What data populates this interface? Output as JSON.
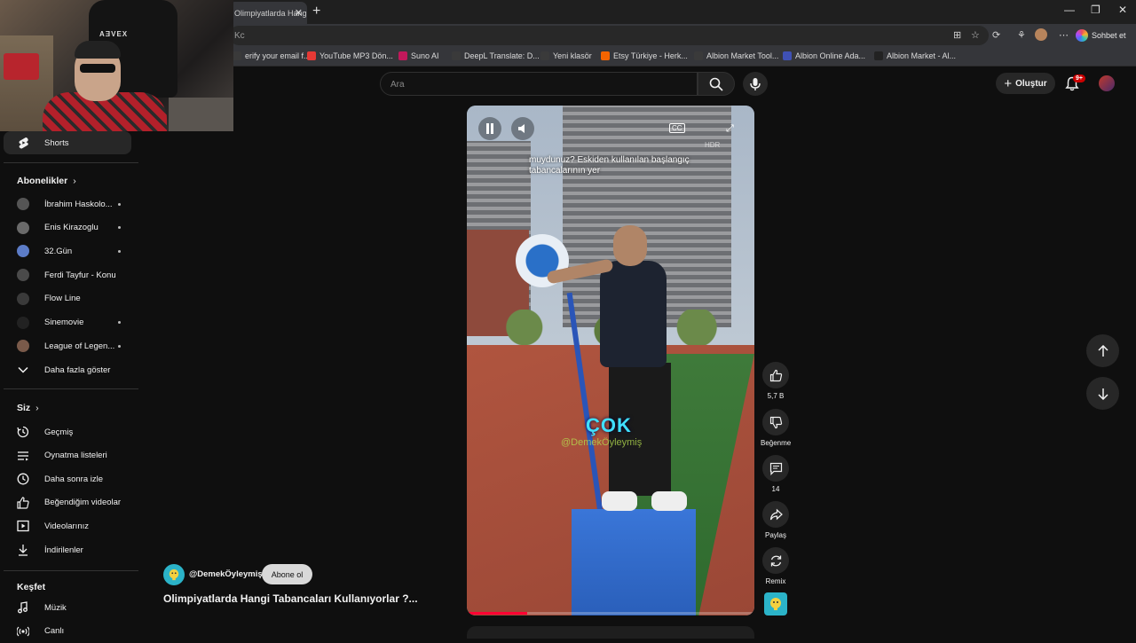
{
  "browser": {
    "tab_title": "Olimpiyatlarda Hangi Ta",
    "url_fragment": "Kc",
    "chat_button": "Sohbet et",
    "bookmarks": [
      {
        "label": "erify your email f...",
        "color": "#3a3a3a"
      },
      {
        "label": "YouTube MP3 Dön...",
        "color": "#e53935"
      },
      {
        "label": "Suno AI",
        "color": "#c2185b"
      },
      {
        "label": "DeepL Translate: D...",
        "color": "#3a3a3a"
      },
      {
        "label": "Yeni klasör",
        "color": "#3a3a3a"
      },
      {
        "label": "Etsy Türkiye - Herk...",
        "color": "#f56400"
      },
      {
        "label": "Albion Market Tool...",
        "color": "#3a3a3a"
      },
      {
        "label": "Albion Online Ada...",
        "color": "#3f51b5"
      },
      {
        "label": "Albion Market - Al...",
        "color": "#222222"
      }
    ]
  },
  "webcam": {
    "chair_brand": "AƎVEX"
  },
  "header": {
    "search_placeholder": "Ara",
    "create_label": "Oluştur",
    "notification_count": "9+"
  },
  "sidebar": {
    "shorts_label": "Shorts",
    "subscriptions_heading": "Abonelikler",
    "subscriptions": [
      {
        "label": "İbrahim Haskolo...",
        "dot": true,
        "color": "#555"
      },
      {
        "label": "Enis Kirazoglu",
        "dot": true,
        "color": "#6a6a6a"
      },
      {
        "label": "32.Gün",
        "dot": true,
        "color": "#5c7cc7"
      },
      {
        "label": "Ferdi Tayfur - Konu",
        "dot": false,
        "color": "#4a4a4a"
      },
      {
        "label": "Flow Line",
        "dot": false,
        "color": "#3a3a3a"
      },
      {
        "label": "Sinemovie",
        "dot": true,
        "color": "#222"
      },
      {
        "label": "League of Legen...",
        "dot": true,
        "color": "#7a5a4a"
      }
    ],
    "show_more_label": "Daha fazla göster",
    "you_heading": "Siz",
    "you_items": [
      {
        "label": "Geçmiş",
        "icon": "history-icon"
      },
      {
        "label": "Oynatma listeleri",
        "icon": "playlist-icon"
      },
      {
        "label": "Daha sonra izle",
        "icon": "clock-icon"
      },
      {
        "label": "Beğendiğim videolar",
        "icon": "thumbs-up-icon"
      },
      {
        "label": "Videolarınız",
        "icon": "video-icon"
      },
      {
        "label": "İndirilenler",
        "icon": "download-icon"
      }
    ],
    "explore_heading": "Keşfet",
    "explore_items": [
      {
        "label": "Müzik",
        "icon": "music-icon"
      },
      {
        "label": "Canlı",
        "icon": "live-icon"
      }
    ]
  },
  "video": {
    "caption": "muydunuz? Eskiden kullanılan başlangıç tabancalarının yer",
    "overlay_word": "ÇOK",
    "overlay_handle": "@DemekÖyleymiş",
    "cc_label": "CC",
    "hdr_label": "HDR",
    "progress": 0.21
  },
  "actions": {
    "like_count": "5,7 B",
    "dislike_label": "Beğenme",
    "comment_count": "14",
    "share_label": "Paylaş",
    "remix_label": "Remix"
  },
  "channel": {
    "name": "@DemekÖyleymiş",
    "subscribe_label": "Abone ol",
    "video_title": "Olimpiyatlarda Hangi Tabancaları Kullanıyorlar ?..."
  }
}
